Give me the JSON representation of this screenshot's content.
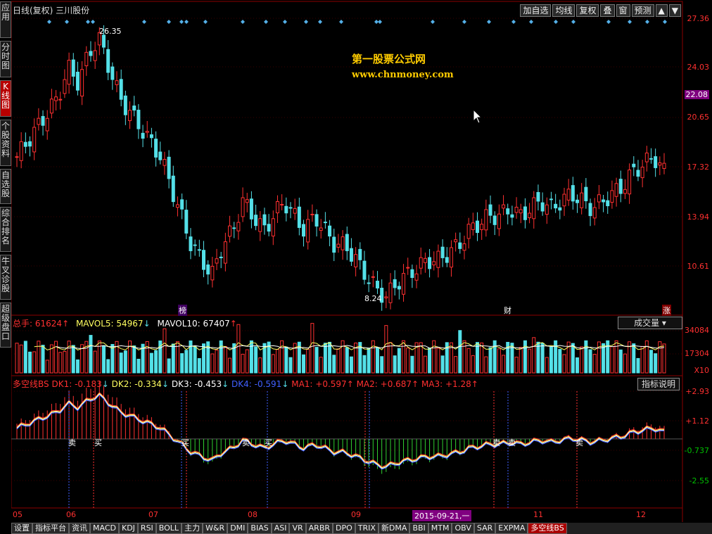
{
  "sidebar": {
    "tabs": [
      {
        "label": "应用",
        "active": false
      },
      {
        "label": "分时图",
        "active": false
      },
      {
        "label": "K线图",
        "active": true
      },
      {
        "label": "个股资料",
        "active": false
      },
      {
        "label": "自选股",
        "active": false
      },
      {
        "label": "综合排名",
        "active": false
      },
      {
        "label": "牛叉诊股",
        "active": false
      },
      {
        "label": "超级盘口",
        "active": false
      }
    ]
  },
  "header": {
    "title": "日线(复权) 三川股份"
  },
  "toolbar": {
    "buttons": [
      "加自选",
      "均线",
      "复权",
      "叠",
      "窗",
      "预测"
    ],
    "arrow_up": "▲",
    "arrow_down": "▼"
  },
  "watermark": {
    "title": "第一股票公式网",
    "url": "www.chnmoney.com"
  },
  "price_axis": {
    "ticks": [
      "27.36",
      "24.03",
      "22.08",
      "20.65",
      "17.32",
      "13.94",
      "10.61"
    ],
    "current": "22.08"
  },
  "price_annotations": {
    "high": "26.35",
    "low": "8.24"
  },
  "event_markers": {
    "bang": "榜",
    "cai": "财",
    "zhang": "涨"
  },
  "volume": {
    "legend": {
      "total_label": "总手:",
      "total_value": "61624",
      "mavol5_label": "MAVOL5:",
      "mavol5_value": "54967",
      "mavol10_label": "MAVOL10:",
      "mavol10_value": "67407"
    },
    "select_label": "成交量",
    "axis": [
      "34084",
      "17304",
      "X10"
    ]
  },
  "indicator": {
    "legend": {
      "name": "多空线BS",
      "dk1": "DK1: -0.183",
      "dk2": "DK2: -0.334",
      "dk3": "DK3: -0.453",
      "dk4": "DK4: -0.591",
      "ma1": "MA1: +0.597",
      "ma2": "MA2: +0.687",
      "ma3": "MA3: +1.28"
    },
    "help_label": "指标说明",
    "axis": [
      "+2.93",
      "+1.12",
      "-0.737",
      "-2.55"
    ],
    "signals": [
      "卖",
      "买",
      "买",
      "卖",
      "买",
      "卖",
      "卖",
      "卖"
    ]
  },
  "timeline": {
    "months": [
      "05",
      "06",
      "07",
      "08",
      "09",
      "11",
      "12"
    ],
    "cursor_date": "2015-09-21,一"
  },
  "bottom_tabs": {
    "items": [
      "设置",
      "指标平台",
      "资讯",
      "MACD",
      "KDJ",
      "RSI",
      "BOLL",
      "主力",
      "W&R",
      "DMI",
      "BIAS",
      "ASI",
      "VR",
      "ARBR",
      "DPO",
      "TRIX",
      "新DMA",
      "BBI",
      "MTM",
      "OBV",
      "SAR",
      "EXPMA",
      "多空线BS"
    ],
    "active": "多空线BS"
  },
  "colors": {
    "up": "#ff3030",
    "down": "#54e0e8",
    "axis": "#8b0000",
    "watermark": "#ffcc00",
    "dk1": "#ff3030",
    "dk2": "#ffff60",
    "dk3": "#ffffff",
    "dk4": "#4060ff",
    "ma": "#ff3030"
  }
}
